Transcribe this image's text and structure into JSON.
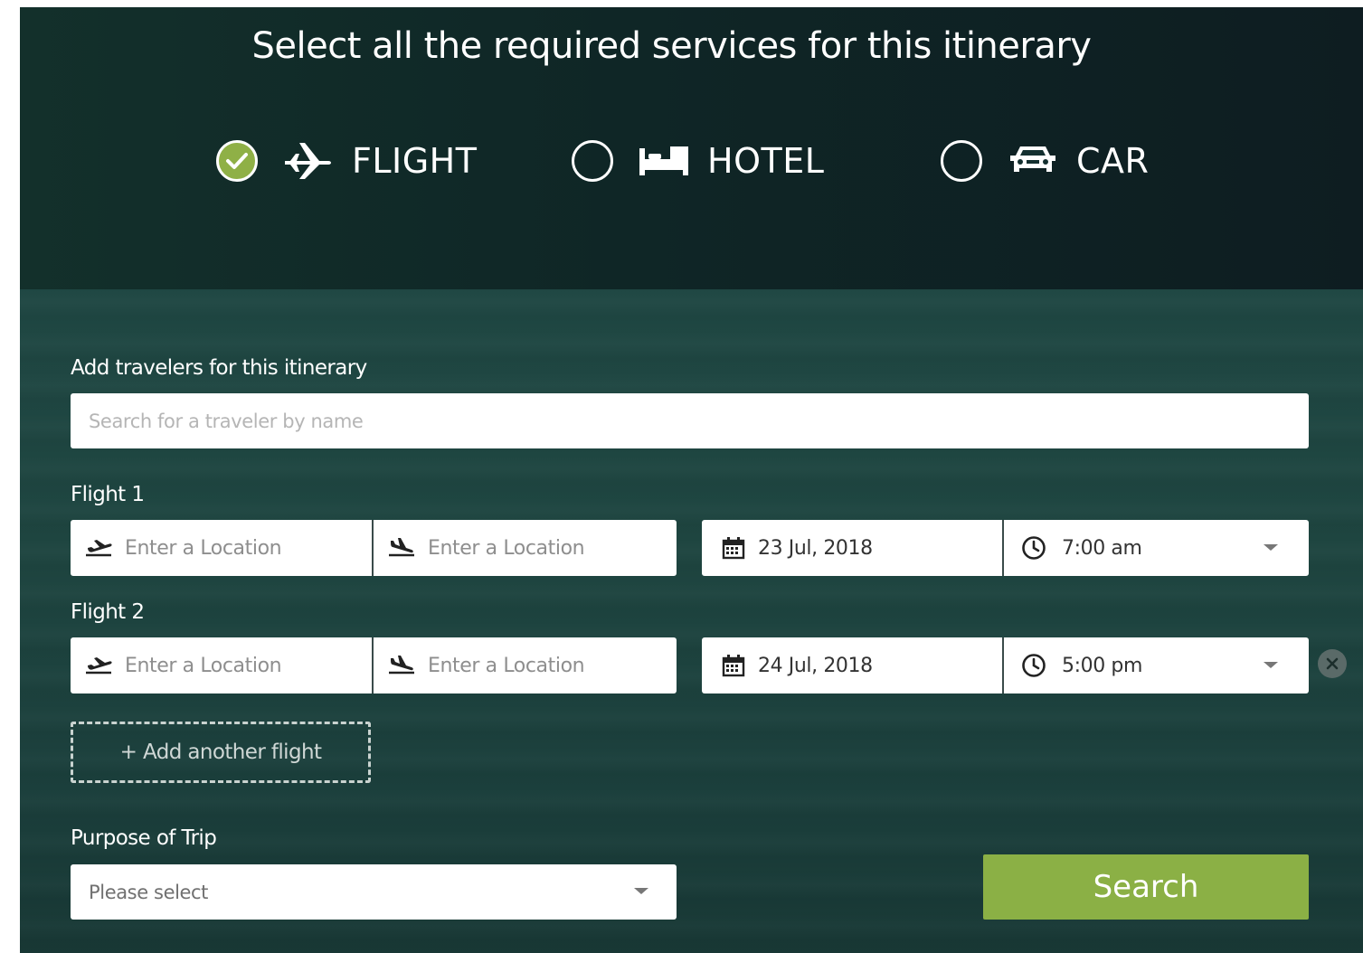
{
  "header": {
    "title": "Select all the required services for this itinerary"
  },
  "services": [
    {
      "label": "FLIGHT",
      "icon": "airplane-icon",
      "checked": true
    },
    {
      "label": "HOTEL",
      "icon": "bed-icon",
      "checked": false
    },
    {
      "label": "CAR",
      "icon": "car-icon",
      "checked": false
    }
  ],
  "travelers": {
    "label": "Add travelers for this itinerary",
    "placeholder": "Search for a traveler by name"
  },
  "flights": [
    {
      "label": "Flight 1",
      "from_placeholder": "Enter a Location",
      "to_placeholder": "Enter a Location",
      "date": "23 Jul, 2018",
      "time": "7:00 am"
    },
    {
      "label": "Flight 2",
      "from_placeholder": "Enter a Location",
      "to_placeholder": "Enter a Location",
      "date": "24 Jul, 2018",
      "time": "5:00 pm"
    }
  ],
  "add_flight_label": "+ Add another flight",
  "purpose": {
    "label": "Purpose of Trip",
    "placeholder": "Please select"
  },
  "search_label": "Search",
  "colors": {
    "accent": "#8bb045",
    "panel_dark": "#0f1e1f",
    "panel_teal": "#1e4540"
  }
}
